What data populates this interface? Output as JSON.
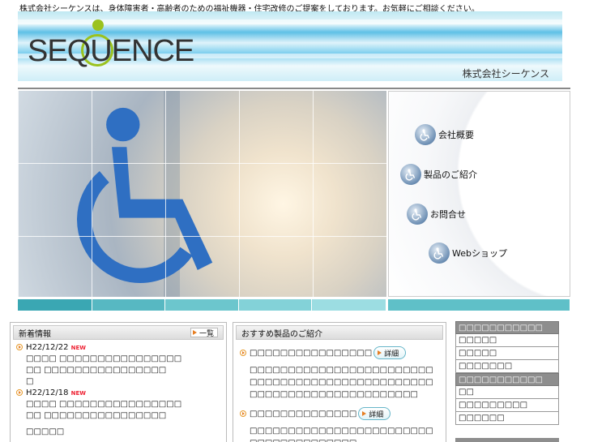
{
  "top_text": "株式会社シーケンスは、身体障害者・高齢者のための福祉機器・住宅改修のご提案をしております。お気軽にご相談ください。",
  "header": {
    "logo_text": "SEQUENCE",
    "company_name": "株式会社シーケンス"
  },
  "hero_menu": {
    "items": [
      {
        "label": "会社概要"
      },
      {
        "label": "製品のご紹介"
      },
      {
        "label": "お問合せ"
      },
      {
        "label": "Webショップ"
      }
    ]
  },
  "strip_colors": [
    "#3aa7b3",
    "#57b8c2",
    "#6cc6cd",
    "#83d2d8",
    "#9cdde2",
    "#5fc0c8"
  ],
  "news": {
    "title": "新着情報",
    "more_label": "一覧",
    "new_badge": "NEW",
    "entries": [
      {
        "date": "H22/12/22",
        "line1": "□□□□ □□□□□□□□□□□□□□□□",
        "line2": "□□ □□□□□□□□□□□□□□□□",
        "line3": "□"
      },
      {
        "date": "H22/12/18",
        "line1": "□□□□ □□□□□□□□□□□□□□□□",
        "line2": "□□ □□□□□□□□□□□□□□□□",
        "line3": "□□□□□"
      }
    ]
  },
  "products": {
    "title": "おすすめ製品のご紹介",
    "detail_label": "詳細",
    "items": [
      {
        "name": "□□□□□□□□□□□□□□□□",
        "desc": "□□□□□□□□□□□□□□□□□□□□□□□□□□□□□□□□□□□□□□□□□□□□□□□□□□□□□□□□□□□□□□□□□□□□□□"
      },
      {
        "name": "□□□□□□□□□□□□□□",
        "desc": "□□□□□□□□□□□□□□□□□□□□□□□□□□□□□□□□□□□□□□"
      }
    ]
  },
  "sidebar": {
    "groups": [
      {
        "head": "□□□□□□□□□□□",
        "items": [
          "□□□□□",
          "□□□□□",
          "□□□□□□□"
        ]
      },
      {
        "head": "□□□□□□□□□□□",
        "items": [
          "□□",
          "□□□□□□□□□",
          "□□□□□□"
        ]
      }
    ]
  }
}
